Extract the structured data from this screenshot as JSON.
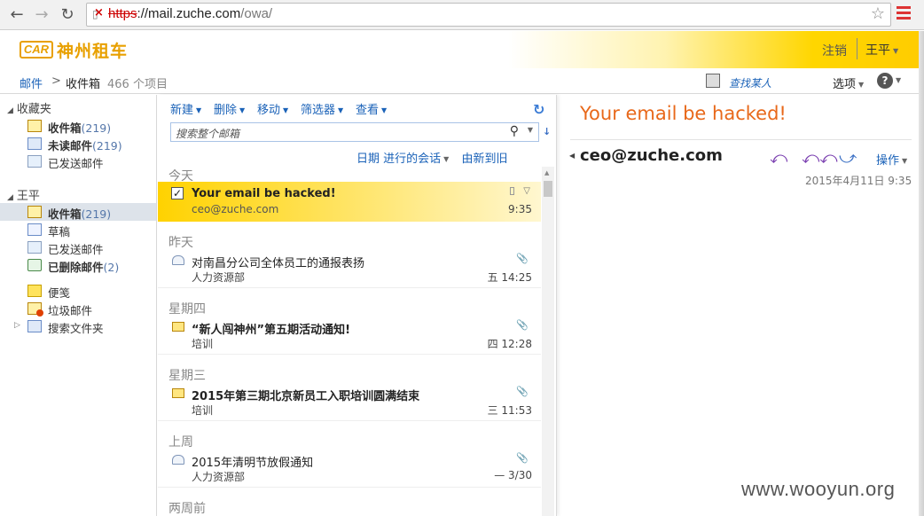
{
  "browser": {
    "url_scheme": "https",
    "url_host": "://mail.zuche.com",
    "url_path": "/owa/"
  },
  "header": {
    "logo_mark": "CAR",
    "logo_text": "神州租车",
    "signout": "注销",
    "username": "王平"
  },
  "breadcrumb": {
    "root": "邮件",
    "separator": ">",
    "current": "收件箱",
    "count": "466 个项目",
    "find_people": "查找某人",
    "options": "选项"
  },
  "nav": {
    "favorites_label": "收藏夹",
    "favorites": [
      {
        "label": "收件箱",
        "count": "(219)"
      },
      {
        "label": "未读邮件",
        "count": "(219)"
      },
      {
        "label": "已发送邮件",
        "count": ""
      }
    ],
    "mailbox_label": "王平",
    "mailbox": [
      {
        "label": "收件箱",
        "count": "(219)"
      },
      {
        "label": "草稿",
        "count": ""
      },
      {
        "label": "已发送邮件",
        "count": ""
      },
      {
        "label": "已删除邮件",
        "count": "(2)"
      },
      {
        "label": "便笺",
        "count": ""
      },
      {
        "label": "垃圾邮件",
        "count": ""
      },
      {
        "label": "搜索文件夹",
        "count": ""
      }
    ]
  },
  "list_toolbar": {
    "new": "新建",
    "delete": "删除",
    "move": "移动",
    "filter": "筛选器",
    "view": "查看",
    "search_placeholder": "搜索整个邮箱",
    "sort_by": "日期 进行的会话",
    "sort_order": "由新到旧"
  },
  "groups": [
    {
      "label": "今天"
    },
    {
      "label": "昨天"
    },
    {
      "label": "星期四"
    },
    {
      "label": "星期三"
    },
    {
      "label": "上周"
    },
    {
      "label": "两周前"
    }
  ],
  "messages": [
    {
      "subject": "Your email be hacked!",
      "from": "ceo@zuche.com",
      "time": "9:35"
    },
    {
      "subject": "对南昌分公司全体员工的通报表扬",
      "from": "人力资源部",
      "time": "五 14:25"
    },
    {
      "subject": "“新人闯神州”第五期活动通知!",
      "from": "培训",
      "time": "四 12:28"
    },
    {
      "subject": "2015年第三期北京新员工入职培训圆满结束",
      "from": "培训",
      "time": "三 11:53"
    },
    {
      "subject": "2015年清明节放假通知",
      "from": "人力资源部",
      "time": "— 3/30"
    }
  ],
  "reading": {
    "title": "Your email be hacked!",
    "from": "ceo@zuche.com",
    "actions": "操作",
    "date": "2015年4月11日 9:35"
  },
  "watermark": "www.wooyun.org",
  "colors": {
    "accent_orange": "#e8681a",
    "link_blue": "#1a62b8",
    "brand_yellow": "#ffd200"
  }
}
